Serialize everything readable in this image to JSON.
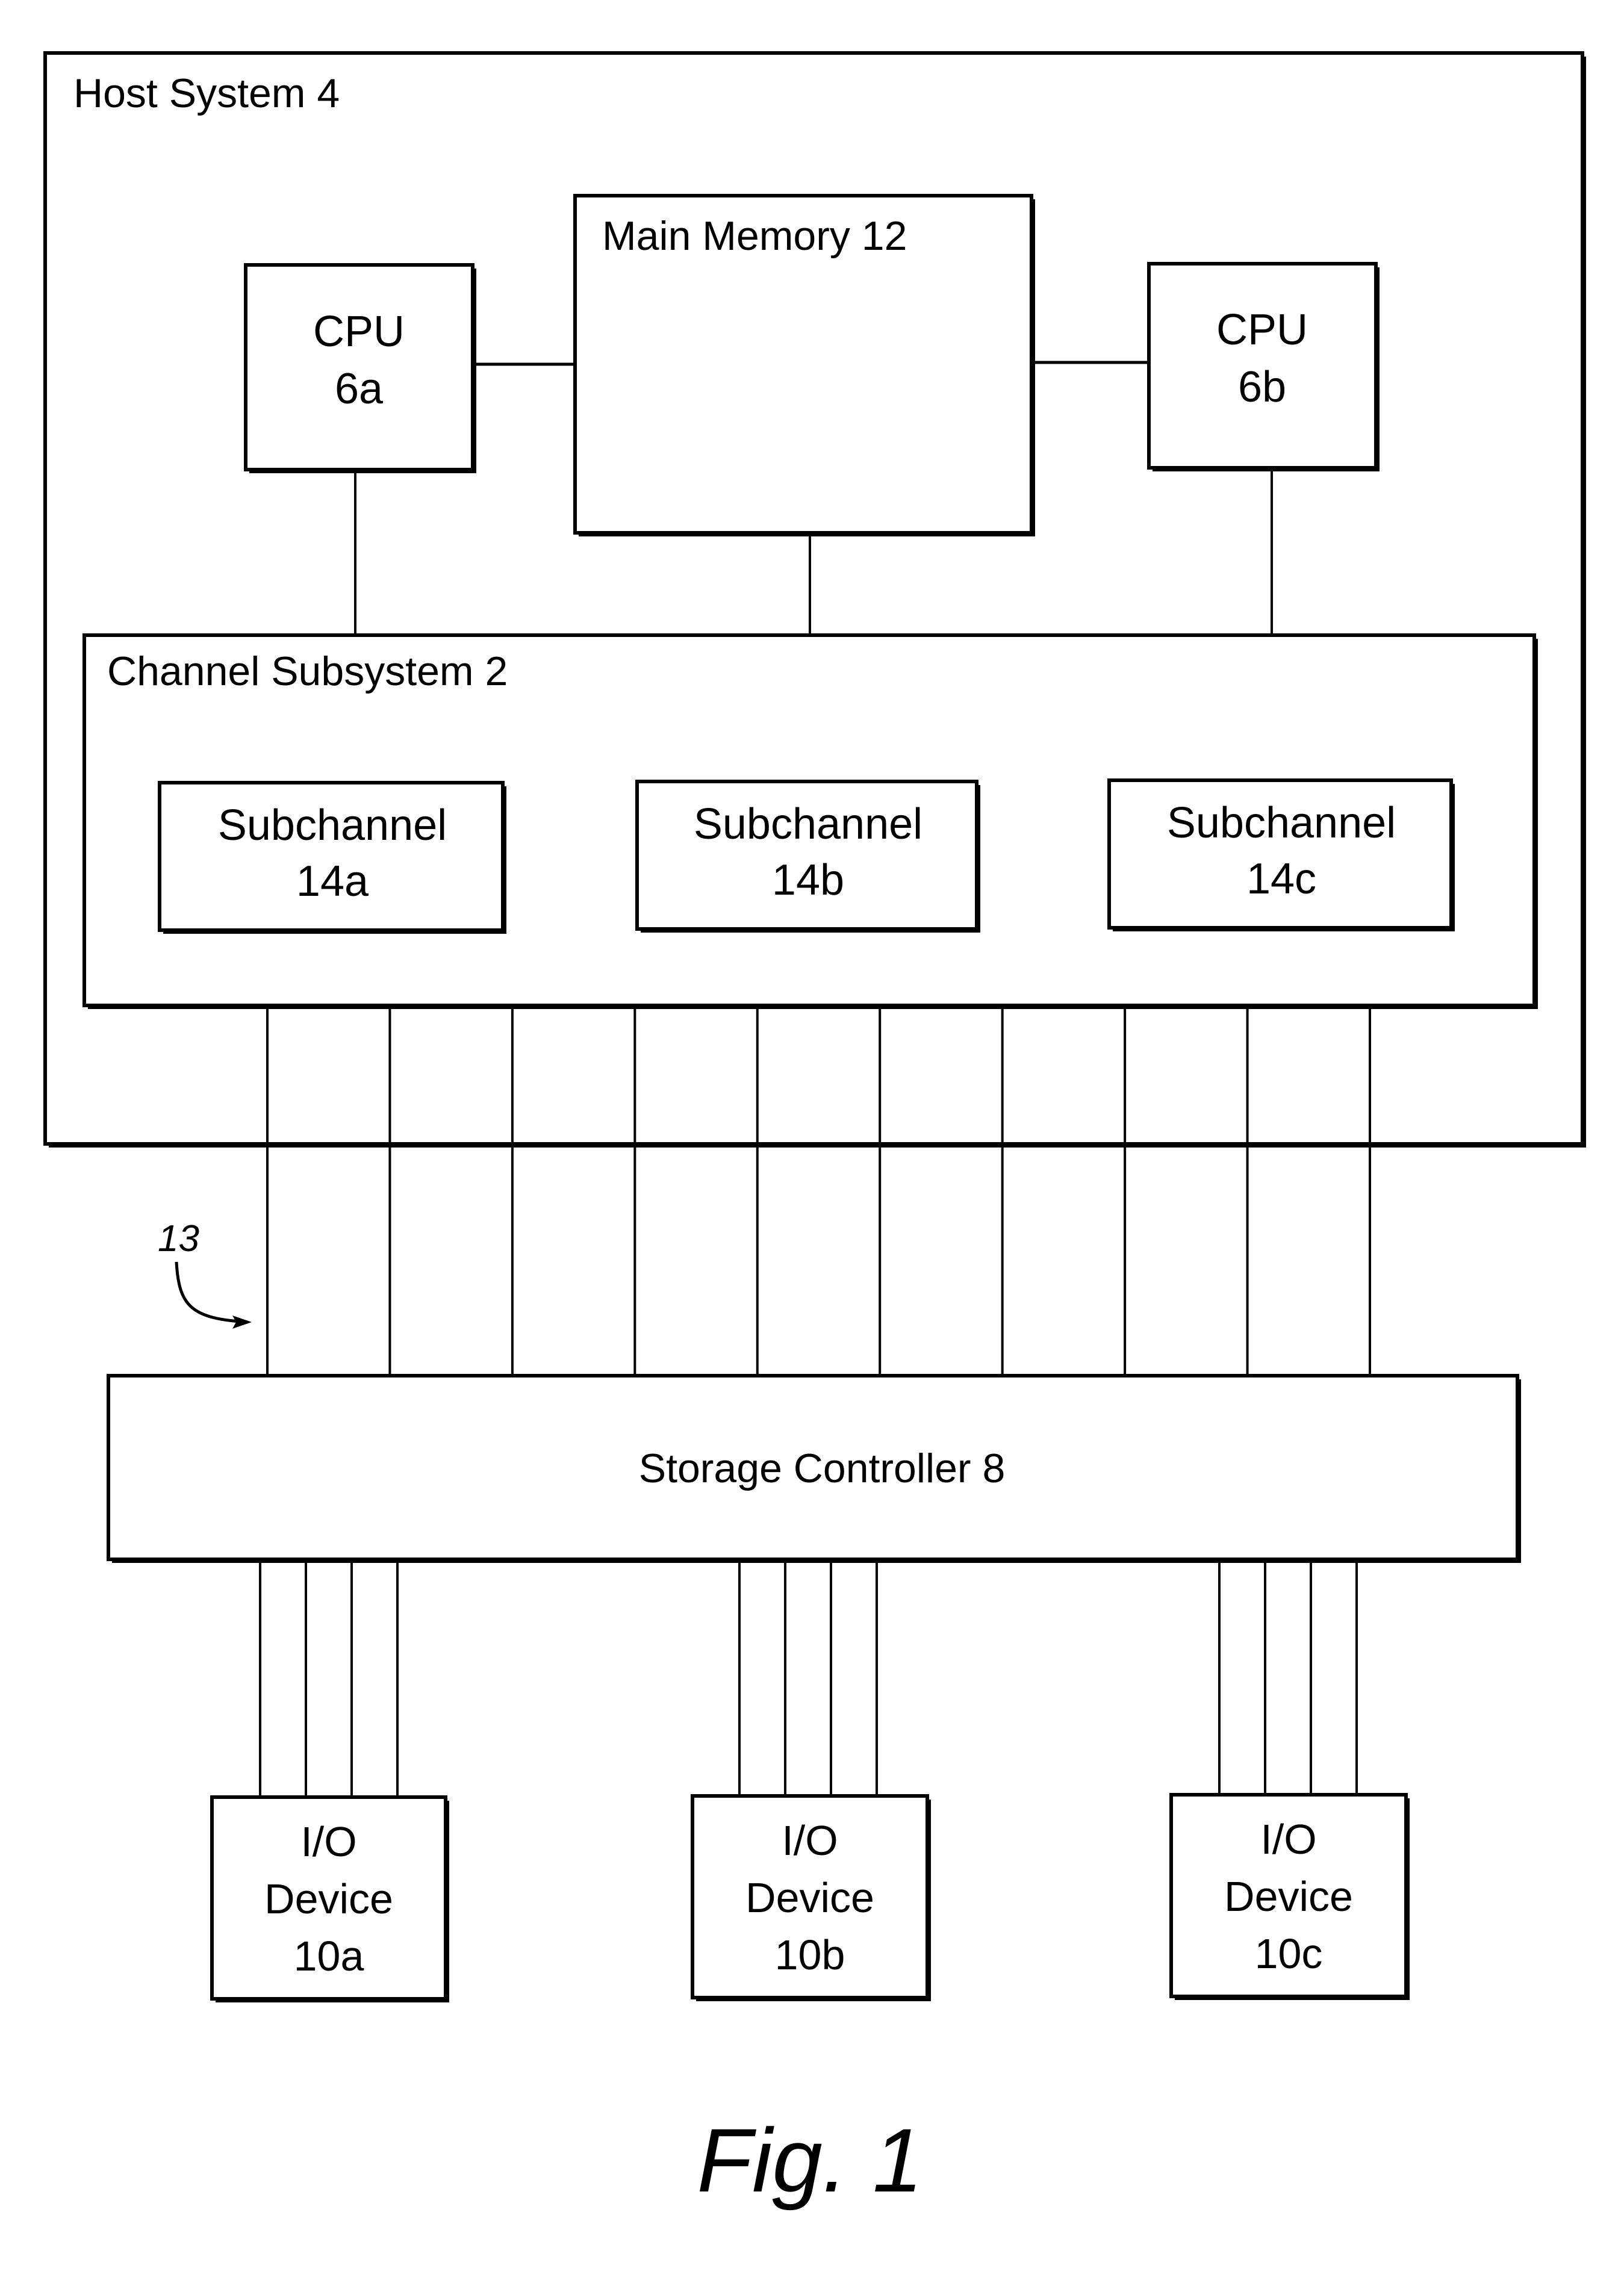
{
  "figure": {
    "caption": "Fig. 1",
    "reference_callout": "13"
  },
  "host_system": {
    "label": "Host System 4"
  },
  "main_memory": {
    "label": "Main Memory 12"
  },
  "cpus": [
    {
      "id": "cpu-6a",
      "line1": "CPU",
      "line2": "6a"
    },
    {
      "id": "cpu-6b",
      "line1": "CPU",
      "line2": "6b"
    }
  ],
  "channel_subsystem": {
    "label": "Channel Subsystem 2",
    "subchannels": [
      {
        "id": "subchannel-14a",
        "line1": "Subchannel",
        "line2": "14a"
      },
      {
        "id": "subchannel-14b",
        "line1": "Subchannel",
        "line2": "14b"
      },
      {
        "id": "subchannel-14c",
        "line1": "Subchannel",
        "line2": "14c"
      }
    ],
    "channel_path_count": 10
  },
  "storage_controller": {
    "label": "Storage Controller 8"
  },
  "io_devices": [
    {
      "id": "io-device-10a",
      "line1": "I/O",
      "line2": "Device",
      "line3": "10a",
      "link_count": 4
    },
    {
      "id": "io-device-10b",
      "line1": "I/O",
      "line2": "Device",
      "line3": "10b",
      "link_count": 4
    },
    {
      "id": "io-device-10c",
      "line1": "I/O",
      "line2": "Device",
      "line3": "10c",
      "link_count": 4
    }
  ]
}
